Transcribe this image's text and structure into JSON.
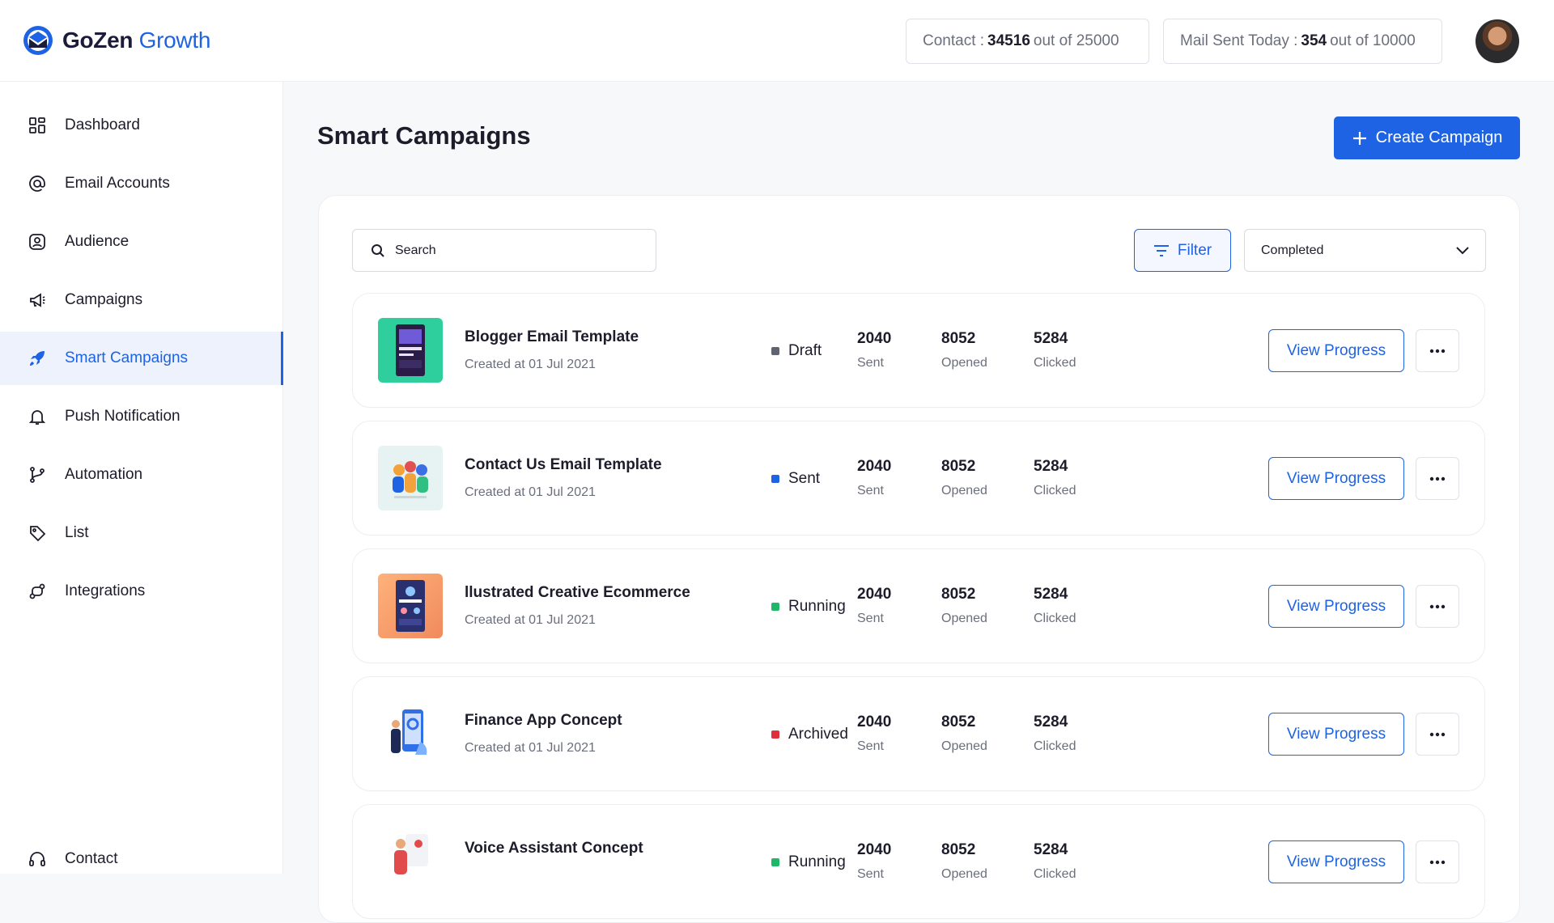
{
  "app": {
    "logo_main": "GoZen",
    "logo_accent": "Growth"
  },
  "header": {
    "contact_stat": {
      "label": "Contact :",
      "value": "34516",
      "suffix": "out of 25000"
    },
    "mail_stat": {
      "label": "Mail Sent Today :",
      "value": "354",
      "suffix": "out of 10000"
    }
  },
  "sidebar": {
    "items": [
      {
        "label": "Dashboard",
        "icon": "dashboard-icon"
      },
      {
        "label": "Email Accounts",
        "icon": "at-icon"
      },
      {
        "label": "Audience",
        "icon": "audience-icon"
      },
      {
        "label": "Campaigns",
        "icon": "megaphone-icon"
      },
      {
        "label": "Smart Campaigns",
        "icon": "rocket-icon",
        "active": true
      },
      {
        "label": "Push Notification",
        "icon": "bell-icon"
      },
      {
        "label": "Automation",
        "icon": "branch-icon"
      },
      {
        "label": "List",
        "icon": "tag-icon"
      },
      {
        "label": "Integrations",
        "icon": "integrations-icon"
      }
    ],
    "bottom_item": {
      "label": "Contact",
      "icon": "headset-icon"
    }
  },
  "main": {
    "title": "Smart Campaigns",
    "create_label": "Create Campaign",
    "search_placeholder": "Search",
    "filter_label": "Filter",
    "status_select": "Completed",
    "columns": {
      "sent": "Sent",
      "opened": "Opened",
      "clicked": "Clicked"
    },
    "view_label": "View Progress",
    "campaigns": [
      {
        "name": "Blogger Email Template",
        "created": "Created at 01 Jul 2021",
        "status": "Draft",
        "status_color": "#5f6470",
        "sent": "2040",
        "opened": "8052",
        "clicked": "5284",
        "thumb": "teal"
      },
      {
        "name": "Contact Us Email Template",
        "created": "Created at 01 Jul 2021",
        "status": "Sent",
        "status_color": "#1e63e3",
        "sent": "2040",
        "opened": "8052",
        "clicked": "5284",
        "thumb": "people"
      },
      {
        "name": "llustrated Creative Ecommerce",
        "created": "Created at 01 Jul 2021",
        "status": "Running",
        "status_color": "#1fb86b",
        "sent": "2040",
        "opened": "8052",
        "clicked": "5284",
        "thumb": "orange"
      },
      {
        "name": "Finance App Concept",
        "created": "Created at 01 Jul 2021",
        "status": "Archived",
        "status_color": "#e0303b",
        "sent": "2040",
        "opened": "8052",
        "clicked": "5284",
        "thumb": "phone"
      },
      {
        "name": "Voice Assistant Concept",
        "created": "",
        "status": "Running",
        "status_color": "#1fb86b",
        "sent": "2040",
        "opened": "8052",
        "clicked": "5284",
        "thumb": "voice"
      }
    ]
  }
}
